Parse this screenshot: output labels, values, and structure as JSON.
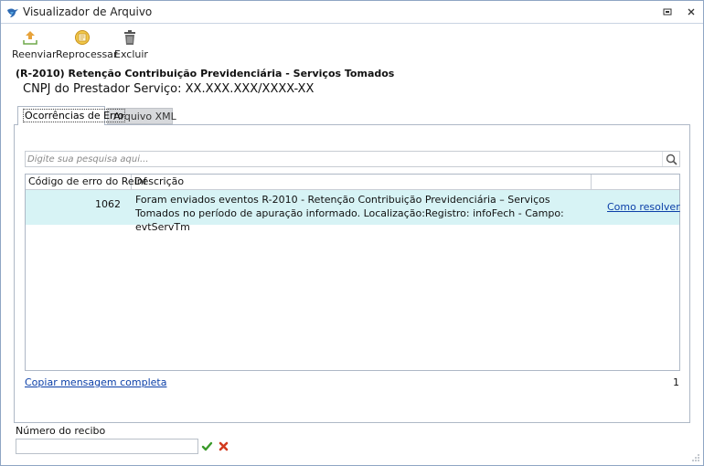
{
  "window": {
    "title": "Visualizador de Arquivo",
    "icon": "bird-logo-icon"
  },
  "toolbar": {
    "resend_label": "Reenviar",
    "reprocess_label": "Reprocessar",
    "delete_label": "Excluir"
  },
  "file": {
    "title": "(R-2010) Retenção Contribuição Previdenciária - Serviços Tomados",
    "cnpj": "CNPJ do Prestador Serviço: XX.XXX.XXX/XXXX-XX"
  },
  "tabs": [
    {
      "label": "Ocorrências de Erro",
      "active": true
    },
    {
      "label": "Arquivo XML",
      "active": false
    }
  ],
  "search": {
    "placeholder": "Digite sua pesquisa aqui..."
  },
  "grid": {
    "columns": [
      "Código de erro do Reinf",
      "Descrição",
      ""
    ],
    "rows": [
      {
        "code": "1062",
        "description": "Foram enviados eventos R-2010 - Retenção Contribuição Previdenciária – Serviços Tomados no período de apuração informado. Localização:Registro: infoFech - Campo: evtServTm",
        "action": "Como resolver"
      }
    ]
  },
  "footer": {
    "copy_label": "Copiar mensagem completa",
    "count": "1"
  },
  "receipt": {
    "label": "Número do recibo",
    "value": ""
  },
  "colors": {
    "row_highlight": "#d7f3f5",
    "link": "#0b3fa8",
    "confirm": "#3a9a2a",
    "cancel": "#d23a1e"
  }
}
